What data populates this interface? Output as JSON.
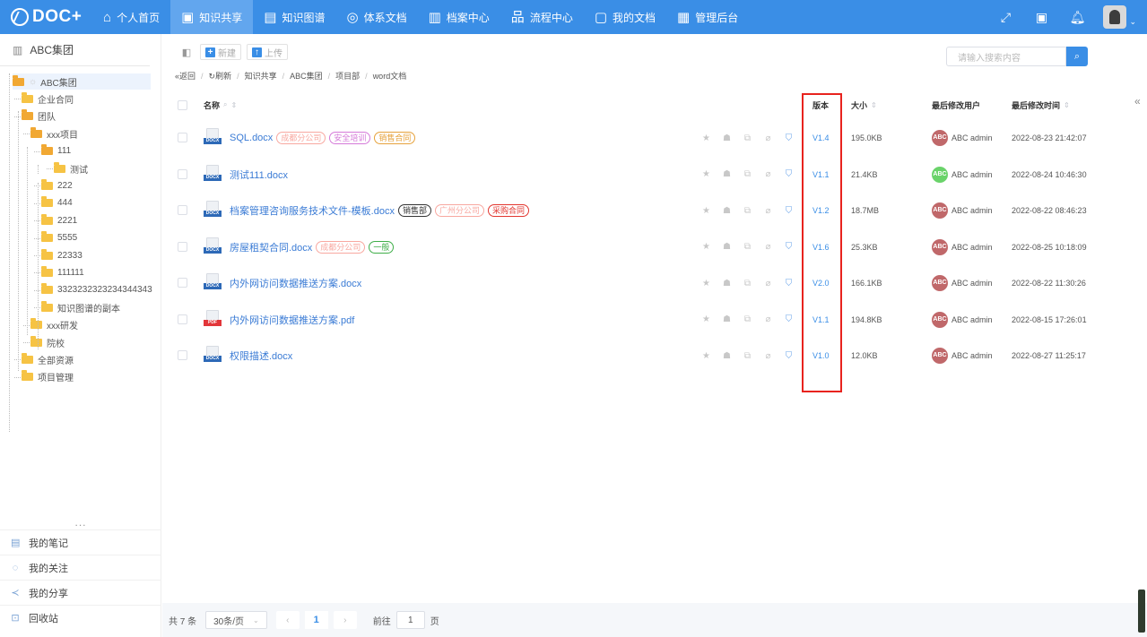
{
  "app": {
    "logo": "DOC+"
  },
  "nav": [
    {
      "label": "个人首页",
      "icon": "home-icon",
      "glyph": "⌂",
      "active": false
    },
    {
      "label": "知识共享",
      "icon": "share-board-icon",
      "glyph": "▣",
      "active": true
    },
    {
      "label": "知识图谱",
      "icon": "graph-icon",
      "glyph": "▤",
      "active": false
    },
    {
      "label": "体系文档",
      "icon": "system-docs-icon",
      "glyph": "◎",
      "active": false
    },
    {
      "label": "档案中心",
      "icon": "archive-icon",
      "glyph": "▥",
      "active": false
    },
    {
      "label": "流程中心",
      "icon": "flow-icon",
      "glyph": "品",
      "active": false
    },
    {
      "label": "我的文档",
      "icon": "my-docs-icon",
      "glyph": "▢",
      "active": false
    },
    {
      "label": "管理后台",
      "icon": "admin-icon",
      "glyph": "▦",
      "active": false
    }
  ],
  "sidebar": {
    "org": "ABC集团",
    "more": "...",
    "tree": [
      {
        "label": "ABC集团",
        "level": 0,
        "open": true,
        "selected": true
      },
      {
        "label": "企业合同",
        "level": 1,
        "open": false
      },
      {
        "label": "团队",
        "level": 1,
        "open": true
      },
      {
        "label": "xxx项目",
        "level": 2,
        "open": true
      },
      {
        "label": "111",
        "level": 3,
        "open": true
      },
      {
        "label": "测试",
        "level": 4,
        "open": false
      },
      {
        "label": "222",
        "level": 3,
        "open": false
      },
      {
        "label": "444",
        "level": 3,
        "open": false
      },
      {
        "label": "2221",
        "level": 3,
        "open": false
      },
      {
        "label": "5555",
        "level": 3,
        "open": false
      },
      {
        "label": "22333",
        "level": 3,
        "open": false
      },
      {
        "label": "111111",
        "level": 3,
        "open": false
      },
      {
        "label": "3323232323234344343",
        "level": 3,
        "open": false
      },
      {
        "label": "知识图谱的副本",
        "level": 3,
        "open": false
      },
      {
        "label": "xxx研发",
        "level": 2,
        "open": false
      },
      {
        "label": "院校",
        "level": 2,
        "open": false
      },
      {
        "label": "全部资源",
        "level": 1,
        "open": false
      },
      {
        "label": "项目管理",
        "level": 1,
        "open": false
      }
    ],
    "bottom": [
      {
        "label": "我的笔记",
        "icon": "notes-icon",
        "glyph": "▤"
      },
      {
        "label": "我的关注",
        "icon": "follow-icon",
        "glyph": "◌"
      },
      {
        "label": "我的分享",
        "icon": "share-icon",
        "glyph": "≺"
      },
      {
        "label": "回收站",
        "icon": "trash-icon",
        "glyph": "⊡"
      }
    ]
  },
  "toolbar": {
    "new_label": "新建",
    "upload_label": "上传"
  },
  "breadcrumb": [
    "«返回",
    "↻刷新",
    "知识共享",
    "ABC集团",
    "项目部",
    "word文档"
  ],
  "search": {
    "placeholder": "请输入搜索内容"
  },
  "table": {
    "headers": {
      "name": "名称",
      "version": "版本",
      "size": "大小",
      "user": "最后修改用户",
      "time": "最后修改时间"
    },
    "rows": [
      {
        "type": "docx",
        "name": "SQL.docx",
        "tags": [
          {
            "text": "成都分公司",
            "color": "#f8a8a0"
          },
          {
            "text": "安全培训",
            "color": "#d57ad9"
          },
          {
            "text": "销售合同",
            "color": "#e6a23c"
          }
        ],
        "version": "V1.4",
        "size": "195.0KB",
        "avatar_text": "ABC",
        "avatar_color": "#c0686a",
        "user": "ABC admin",
        "time": "2022-08-23 21:42:07"
      },
      {
        "type": "docx",
        "name": "测试111.docx",
        "tags": [],
        "version": "V1.1",
        "size": "21.4KB",
        "avatar_text": "ABC",
        "avatar_color": "#6ad36a",
        "user": "ABC admin",
        "time": "2022-08-24 10:46:30"
      },
      {
        "type": "docx",
        "name": "档案管理咨询服务技术文件-模板.docx",
        "tags": [
          {
            "text": "销售部",
            "color": "#333333"
          },
          {
            "text": "广州分公司",
            "color": "#f8a8a0"
          },
          {
            "text": "采购合同",
            "color": "#e2362f"
          }
        ],
        "version": "V1.2",
        "size": "18.7MB",
        "avatar_text": "ABC",
        "avatar_color": "#c0686a",
        "user": "ABC admin",
        "time": "2022-08-22 08:46:23"
      },
      {
        "type": "docx",
        "name": "房屋租契合同.docx",
        "tags": [
          {
            "text": "成都分公司",
            "color": "#f8a8a0"
          },
          {
            "text": "一般",
            "color": "#3fae49"
          }
        ],
        "version": "V1.6",
        "size": "25.3KB",
        "avatar_text": "ABC",
        "avatar_color": "#c0686a",
        "user": "ABC admin",
        "time": "2022-08-25 10:18:09"
      },
      {
        "type": "docx",
        "name": "内外网访问数据推送方案.docx",
        "tags": [],
        "version": "V2.0",
        "size": "166.1KB",
        "avatar_text": "ABC",
        "avatar_color": "#c0686a",
        "user": "ABC admin",
        "time": "2022-08-22 11:30:26"
      },
      {
        "type": "pdf",
        "name": "内外网访问数据推送方案.pdf",
        "tags": [],
        "version": "V1.1",
        "size": "194.8KB",
        "avatar_text": "ABC",
        "avatar_color": "#c0686a",
        "user": "ABC admin",
        "time": "2022-08-15 17:26:01"
      },
      {
        "type": "docx",
        "name": "权限描述.docx",
        "tags": [],
        "version": "V1.0",
        "size": "12.0KB",
        "avatar_text": "ABC",
        "avatar_color": "#c0686a",
        "user": "ABC admin",
        "time": "2022-08-27 11:25:17"
      }
    ]
  },
  "pager": {
    "total": "共 7 条",
    "page_size": "30条/页",
    "current": "1",
    "goto_prefix": "前往",
    "goto_value": "1",
    "goto_suffix": "页"
  },
  "colors": {
    "primary": "#3a8ee6",
    "highlight": "#e8231e"
  }
}
